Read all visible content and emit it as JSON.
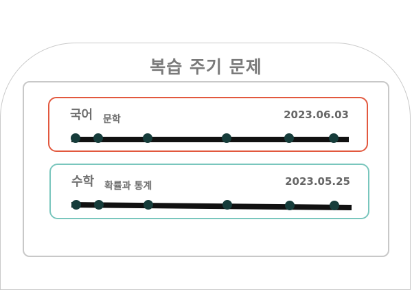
{
  "title": "복습 주기 문제",
  "colors": {
    "title_text": "#7a7a7a",
    "card_korean_border": "#e2583e",
    "card_math_border": "#79c6bd",
    "timeline_line": "#111111",
    "timeline_dot": "#163c3a"
  },
  "cards": [
    {
      "subject": "국어",
      "topic": "문학",
      "date": "2023.06.03",
      "review_points": 6
    },
    {
      "subject": "수학",
      "topic": "확률과 통계",
      "date": "2023.05.25",
      "review_points": 6
    }
  ]
}
